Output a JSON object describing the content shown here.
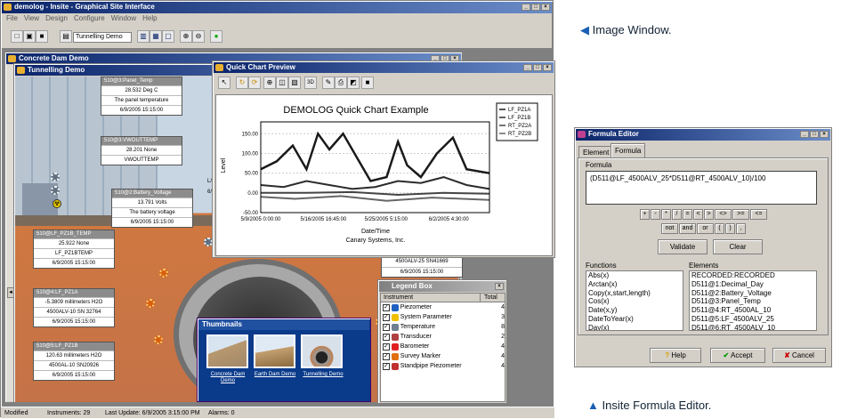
{
  "main_window": {
    "title": "demolog - Insite - Graphical Site Interface",
    "menu": [
      "File",
      "View",
      "Design",
      "Configure",
      "Window",
      "Help"
    ],
    "toolbar_dropdown": "Tunnelling Demo"
  },
  "status_bar": {
    "mode": "Modified",
    "instruments": "Instruments: 29",
    "last_update": "Last Update: 6/9/2005 3:15:00 PM",
    "alarms": "Alarms: 0"
  },
  "concrete_window": {
    "title": "Concrete Dam Demo"
  },
  "tunnel_window": {
    "title": "Tunnelling Demo"
  },
  "panels": [
    {
      "header": "510@3:Panel_Temp",
      "value": "28.532 Deg C",
      "label": "The panel temperature",
      "date": "6/9/2005 15:15:00"
    },
    {
      "header": "510@3:VWOUTTEMP",
      "value": "28.201 None",
      "label": "VWOUTTEMP",
      "date": "6/9/2005 15:15:00"
    },
    {
      "header": "510@2:Battery_Voltage",
      "value": "13.791 Volts",
      "label": "The battery voltage",
      "date": "6/9/2005 15:15:00"
    },
    {
      "header": "510@LF_PZ1B_TEMP",
      "value": "25.922 None",
      "label": "LF_PZ1BTEMP",
      "date": "6/9/2005 15:15:00"
    },
    {
      "header": "510@4:LF_PZ1A",
      "value": "-5.3809 millimeters H2O",
      "label": "4500ALV-10 SN 32764",
      "date": "6/9/2005 15:15:00"
    },
    {
      "header": "510@5:LF_PZ1B",
      "value": "120.63 millimeters H2O",
      "label": "4500AL-10 SN20926",
      "date": "6/9/2005 15:15:00"
    }
  ],
  "partial_panel": {
    "label": "4500ALV-25 SN41669",
    "date": "6/9/2005 15:15:00",
    "side": "L/",
    "side2": "6/"
  },
  "chart_window": {
    "title": "Quick Chart Preview",
    "toolbar_3d": "3D"
  },
  "chart_data": {
    "type": "line",
    "title": "DEMOLOG Quick Chart Example",
    "xlabel": "Date/Time",
    "ylabel": "Level",
    "subtitle": "Canary Systems, Inc.",
    "yticks": [
      "150.00",
      "100.00",
      "50.00",
      "0.00",
      "-50.00"
    ],
    "xticks": [
      "5/9/2005 0:00:00",
      "5/16/2005 16:45:00",
      "5/25/2005 5:15:00",
      "6/2/2005 4:30:00"
    ],
    "ylim": [
      -50,
      180
    ],
    "series": [
      {
        "name": "LF_PZ1A"
      },
      {
        "name": "LF_PZ1B"
      },
      {
        "name": "RT_PZ2A"
      },
      {
        "name": "RT_PZ2B"
      }
    ]
  },
  "legend_window": {
    "title": "Legend Box",
    "col_instrument": "Instrument",
    "col_total": "Total",
    "items": [
      {
        "name": "Piezometer",
        "total": "4",
        "color": "#2060c0"
      },
      {
        "name": "System Parameter",
        "total": "3",
        "color": "#f0c000"
      },
      {
        "name": "Temperature",
        "total": "8",
        "color": "#708090"
      },
      {
        "name": "Transducer",
        "total": "2",
        "color": "#b04040"
      },
      {
        "name": "Barometer",
        "total": "4",
        "color": "#e02020"
      },
      {
        "name": "Survey Marker",
        "total": "4",
        "color": "#e07010"
      },
      {
        "name": "Standpipe Piezometer",
        "total": "4",
        "color": "#c03030"
      }
    ]
  },
  "thumbnails_window": {
    "title": "Thumbnails",
    "items": [
      "Concrete Dam Demo",
      "Earth Dam Demo",
      "Tunnelling Demo"
    ]
  },
  "formula_window": {
    "title": "Formula Editor",
    "tabs": [
      "Element",
      "Formula"
    ],
    "formula_label": "Formula",
    "formula_value": "(D511@LF_4500ALV_25*D511@RT_4500ALV_10)/100",
    "operators_row1": [
      "+",
      "-",
      "*",
      "/",
      "=",
      "<",
      ">",
      "<>",
      ">=",
      "<="
    ],
    "operators_row2": [
      "not",
      "and",
      "or",
      "(",
      ")",
      ","
    ],
    "validate": "Validate",
    "clear": "Clear",
    "functions_label": "Functions",
    "functions": [
      "Abs(x)",
      "Arctan(x)",
      "Copy(x,start,length)",
      "Cos(x)",
      "Date(x,y)",
      "DateToYear(x)",
      "Day(x)",
      "Div(x,y)"
    ],
    "elements_label": "Elements",
    "elements": [
      "RECORDED:RECORDED",
      "D511@1:Decimal_Day",
      "D511@2:Battery_Voltage",
      "D511@3:Panel_Temp",
      "D511@4:RT_4500AL_10",
      "D511@5:LF_4500ALV_25",
      "D511@6:RT_4500ALV_10",
      "D511@7:VWBarn_4500S_50"
    ],
    "help": "Help",
    "accept": "Accept",
    "cancel": "Cancel"
  },
  "captions": {
    "image_window": "Image Window.",
    "formula_editor": "Insite Formula Editor."
  },
  "colors": {
    "accent": "#0a246a",
    "caption_arrow": "#1a5fb4"
  }
}
